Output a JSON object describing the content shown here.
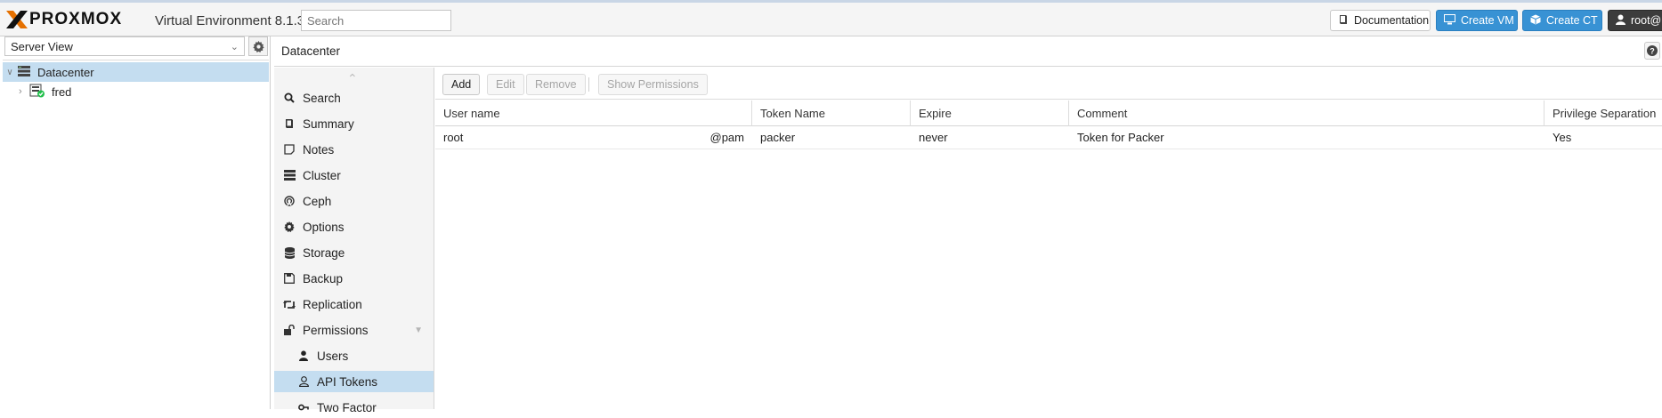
{
  "app": {
    "brand": "PROXMOX",
    "version_label": "Virtual Environment 8.1.3",
    "search_placeholder": "Search"
  },
  "topbar": {
    "documentation": "Documentation",
    "create_vm": "Create VM",
    "create_ct": "Create CT",
    "user": "root@p"
  },
  "sidebar": {
    "view": "Server View",
    "tree": [
      {
        "label": "Datacenter"
      },
      {
        "label": "fred"
      }
    ]
  },
  "breadcrumb": "Datacenter",
  "nav": {
    "items": [
      {
        "label": "Search",
        "icon": "search-icon"
      },
      {
        "label": "Summary",
        "icon": "book-icon"
      },
      {
        "label": "Notes",
        "icon": "note-icon"
      },
      {
        "label": "Cluster",
        "icon": "server-icon"
      },
      {
        "label": "Ceph",
        "icon": "ceph-icon"
      },
      {
        "label": "Options",
        "icon": "gear-icon"
      },
      {
        "label": "Storage",
        "icon": "database-icon"
      },
      {
        "label": "Backup",
        "icon": "floppy-icon"
      },
      {
        "label": "Replication",
        "icon": "retweet-icon"
      },
      {
        "label": "Permissions",
        "icon": "unlock-icon"
      },
      {
        "label": "Users",
        "icon": "user-icon"
      },
      {
        "label": "API Tokens",
        "icon": "user-outline-icon"
      },
      {
        "label": "Two Factor",
        "icon": "key-icon"
      }
    ]
  },
  "toolbar": {
    "add": "Add",
    "edit": "Edit",
    "remove": "Remove",
    "show_permissions": "Show Permissions"
  },
  "grid": {
    "columns": [
      "User name",
      "Token Name",
      "Expire",
      "Comment",
      "Privilege Separation"
    ],
    "rows": [
      {
        "user": "root",
        "realm": "@pam",
        "token": "packer",
        "expire": "never",
        "comment": "Token for Packer",
        "privsep": "Yes"
      }
    ]
  },
  "colors": {
    "accent": "#3892d4",
    "selection": "#c4ddf0",
    "brand_orange": "#e57000"
  }
}
